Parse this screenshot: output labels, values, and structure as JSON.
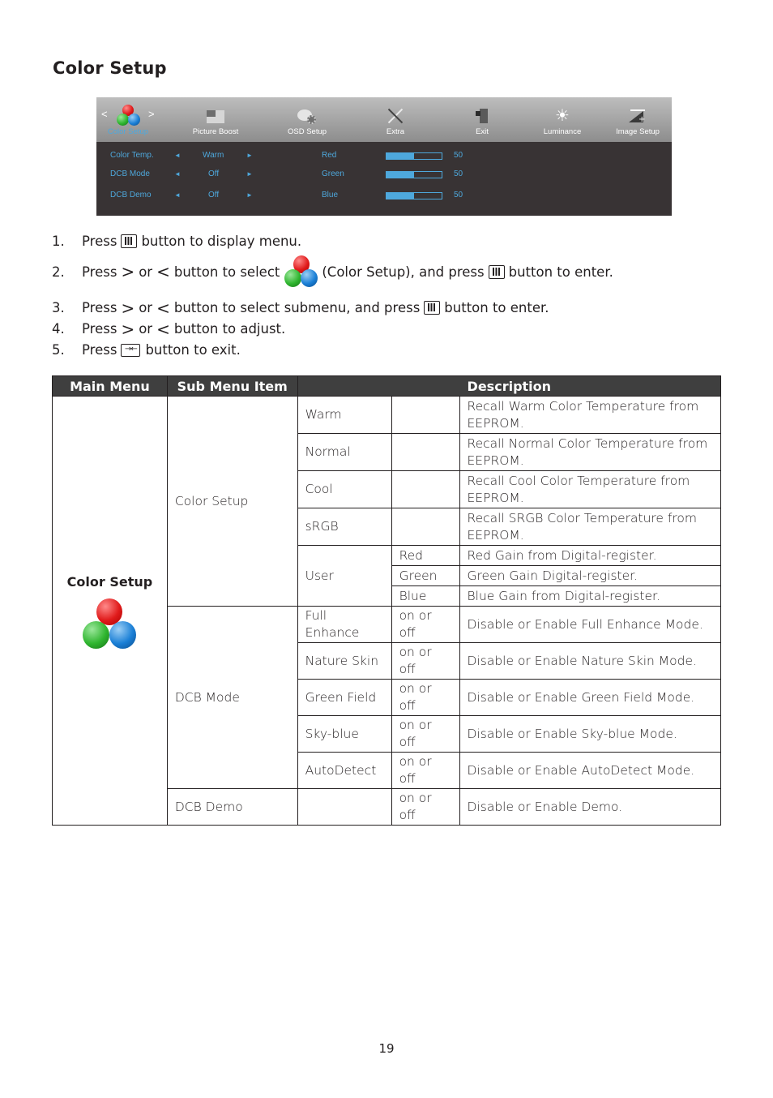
{
  "page": {
    "title": "Color Setup",
    "page_number": "19"
  },
  "osd": {
    "tabs": [
      {
        "label": "Color Setup",
        "icon": "color-orbs-icon",
        "active": true
      },
      {
        "label": "Picture Boost",
        "icon": "picture-boost-icon",
        "active": false
      },
      {
        "label": "OSD Setup",
        "icon": "osd-setup-icon",
        "active": false
      },
      {
        "label": "Extra",
        "icon": "extra-tools-icon",
        "active": false
      },
      {
        "label": "Exit",
        "icon": "exit-door-icon",
        "active": false
      },
      {
        "label": "Luminance",
        "icon": "sun-icon",
        "active": false
      },
      {
        "label": "Image Setup",
        "icon": "image-setup-icon",
        "active": false
      }
    ],
    "nav_left": "<",
    "nav_right": ">",
    "settings": [
      {
        "label": "Color Temp.",
        "value": "Warm"
      },
      {
        "label": "DCB Mode",
        "value": "Off"
      },
      {
        "label": "DCB Demo",
        "value": "Off"
      }
    ],
    "left_arrow": "◄",
    "right_arrow": "►",
    "gains": [
      {
        "label": "Red",
        "value": "50",
        "level": 0.5
      },
      {
        "label": "Green",
        "value": "50",
        "level": 0.5
      },
      {
        "label": "Blue",
        "value": "50",
        "level": 0.5
      }
    ],
    "colors": {
      "accent": "#4ea8dc",
      "panel": "#383334"
    }
  },
  "steps": [
    {
      "num": "1.",
      "parts": [
        "Press",
        "[menu-button]",
        "button to display menu."
      ]
    },
    {
      "num": "2.",
      "parts": [
        "Press",
        ">",
        "or",
        "<",
        "button to select",
        "[color-orbs]",
        "(Color Setup), and press",
        "[menu-button]",
        "button to enter."
      ]
    },
    {
      "num": "3.",
      "parts": [
        "Press",
        ">",
        "or",
        "<",
        "button to select submenu, and press",
        "[menu-button]",
        "button to enter."
      ]
    },
    {
      "num": "4.",
      "parts": [
        "Press",
        ">",
        "or",
        "<",
        "button to adjust."
      ]
    },
    {
      "num": "5.",
      "parts": [
        "Press",
        "[exit-button]",
        "button to exit."
      ]
    }
  ],
  "step_text": {
    "s1_num": "1.",
    "s1_a": "Press",
    "s1_b": "button to display menu.",
    "s2_num": "2.",
    "s2_a": "Press",
    "s2_gt": ">",
    "s2_or": "or",
    "s2_lt": "<",
    "s2_b": "button to select",
    "s2_c": "(Color Setup), and press",
    "s2_d": "button to enter.",
    "s3_num": "3.",
    "s3_a": "Press",
    "s3_gt": ">",
    "s3_or": "or",
    "s3_lt": "<",
    "s3_b": "button to select submenu, and press",
    "s3_c": "button to enter.",
    "s4_num": "4.",
    "s4_a": "Press",
    "s4_gt": ">",
    "s4_or": "or",
    "s4_lt": "<",
    "s4_b": "button to adjust.",
    "s5_num": "5.",
    "s5_a": "Press",
    "s5_b": "button to exit."
  },
  "table": {
    "headers": [
      "Main Menu",
      "Sub Menu Item",
      "Description"
    ],
    "main_menu": "Color Setup",
    "groups": {
      "color_setup": {
        "label": "Color Setup",
        "rows": [
          {
            "item": "Warm",
            "value": "",
            "desc": "Recall Warm Color Temperature from EEPROM."
          },
          {
            "item": "Normal",
            "value": "",
            "desc": "Recall Normal Color Temperature from EEPROM."
          },
          {
            "item": "Cool",
            "value": "",
            "desc": "Recall Cool Color Temperature from EEPROM."
          },
          {
            "item": "sRGB",
            "value": "",
            "desc": "Recall SRGB Color Temperature from EEPROM."
          }
        ],
        "user": {
          "item": "User",
          "rows": [
            {
              "value": "Red",
              "desc": "Red Gain from Digital-register."
            },
            {
              "value": "Green",
              "desc": "Green Gain Digital-register."
            },
            {
              "value": "Blue",
              "desc": "Blue Gain from Digital-register."
            }
          ]
        }
      },
      "dcb_mode": {
        "label": "DCB Mode",
        "rows": [
          {
            "item": "Full Enhance",
            "value": "on or off",
            "desc": "Disable or Enable Full Enhance Mode."
          },
          {
            "item": "Nature Skin",
            "value": "on or off",
            "desc": "Disable or Enable Nature Skin Mode."
          },
          {
            "item": "Green Field",
            "value": "on or off",
            "desc": "Disable or Enable Green Field Mode."
          },
          {
            "item": "Sky-blue",
            "value": "on or off",
            "desc": "Disable or Enable Sky-blue Mode."
          },
          {
            "item": "AutoDetect",
            "value": "on or off",
            "desc": "Disable or Enable AutoDetect Mode."
          }
        ]
      },
      "dcb_demo": {
        "label": "DCB Demo",
        "item": "",
        "value": "on or off",
        "desc": "Disable or Enable Demo."
      }
    }
  }
}
